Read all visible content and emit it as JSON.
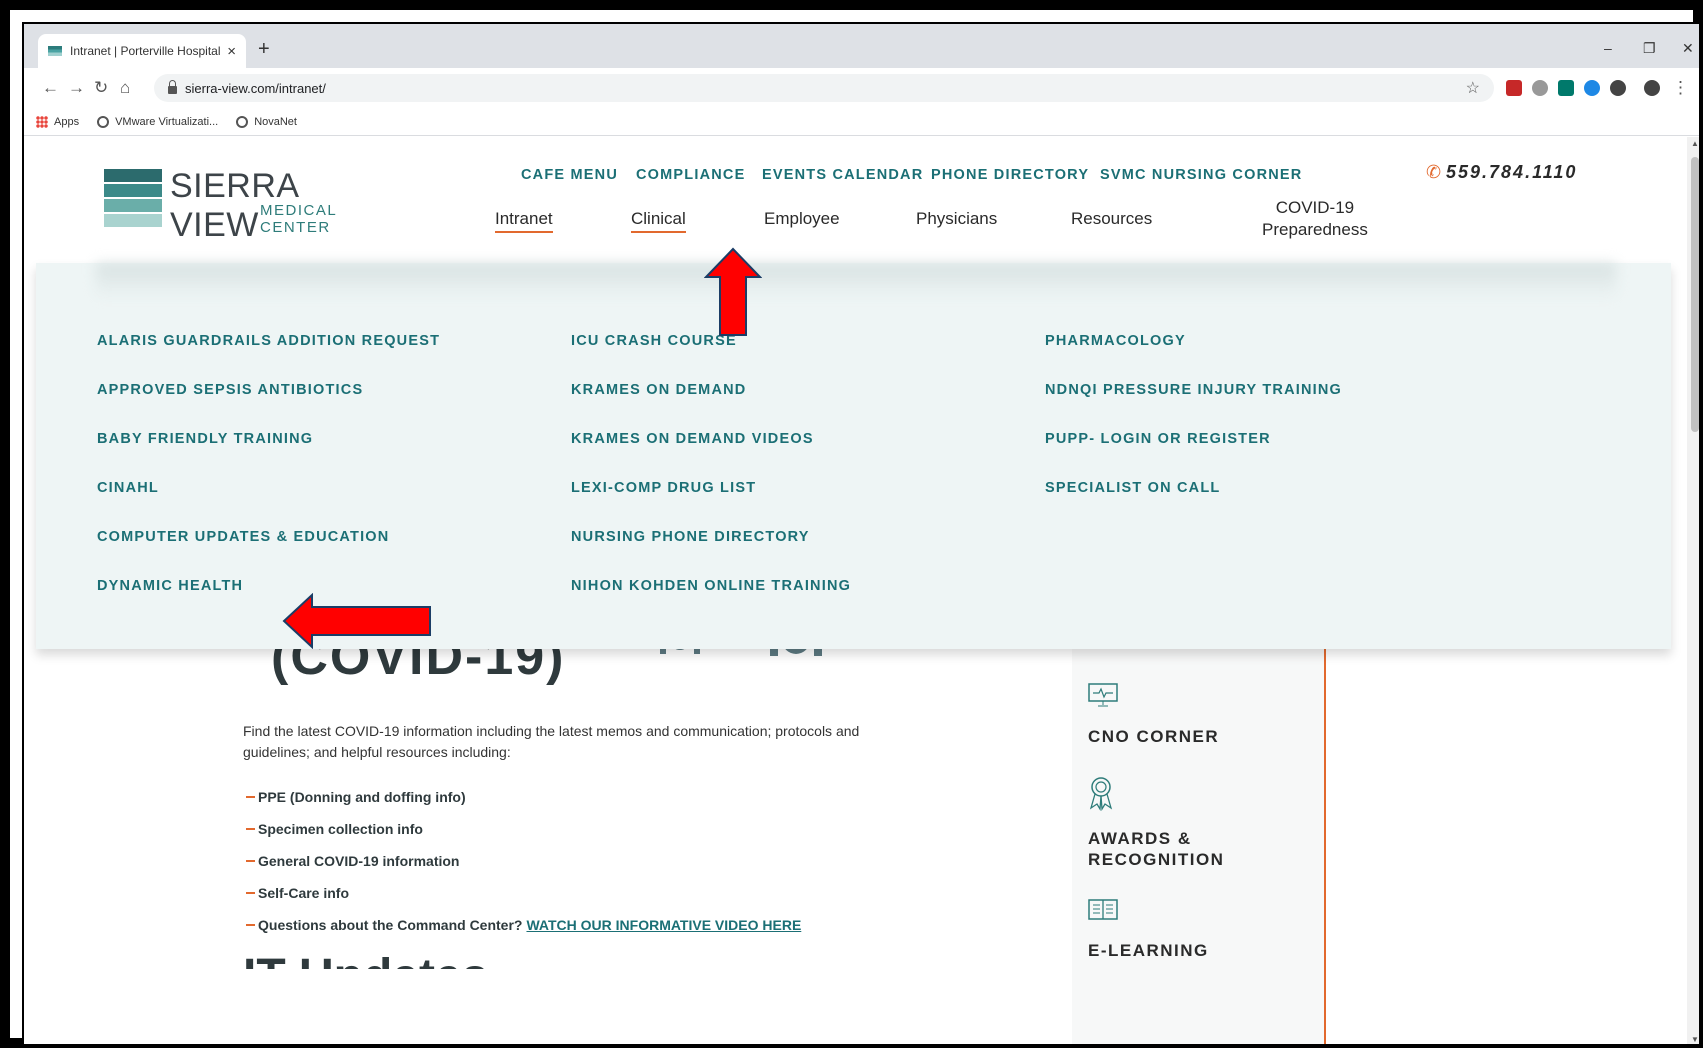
{
  "browser": {
    "tab_title": "Intranet | Porterville Hospital",
    "tab_close": "×",
    "new_tab": "+",
    "url": "sierra-view.com/intranet/",
    "window_controls": [
      "–",
      "❐",
      "✕"
    ],
    "bookmarks": [
      {
        "label": "Apps",
        "icon": "apps-grid-icon"
      },
      {
        "label": "VMware Virtualizati...",
        "icon": "globe-icon"
      },
      {
        "label": "NovaNet",
        "icon": "globe-icon"
      }
    ]
  },
  "logo": {
    "name": "SIERRA VIEW",
    "sub": "MEDICAL CENTER"
  },
  "top_links": [
    "CAFE MENU",
    "COMPLIANCE",
    "EVENTS CALENDAR",
    "PHONE DIRECTORY",
    "SVMC NURSING CORNER"
  ],
  "phone": "559.784.1110",
  "main_nav": [
    {
      "label": "Intranet",
      "active": true
    },
    {
      "label": "Clinical",
      "active": true
    },
    {
      "label": "Employee"
    },
    {
      "label": "Physicians"
    },
    {
      "label": "Resources"
    },
    {
      "label": "COVID-19 Preparedness",
      "line1": "COVID-19",
      "line2": "Preparedness"
    }
  ],
  "mega_menu": {
    "col1": [
      "ALARIS GUARDRAILS ADDITION REQUEST",
      "APPROVED SEPSIS ANTIBIOTICS",
      "BABY FRIENDLY TRAINING",
      "CINAHL",
      "COMPUTER UPDATES & EDUCATION",
      "DYNAMIC HEALTH"
    ],
    "col2": [
      "ICU CRASH COURSE",
      "KRAMES ON DEMAND",
      "KRAMES ON DEMAND VIDEOS",
      "LEXI-COMP DRUG LIST",
      "NURSING PHONE DIRECTORY",
      "NIHON KOHDEN ONLINE TRAINING"
    ],
    "col3": [
      "PHARMACOLOGY",
      "NDNQI PRESSURE INJURY TRAINING",
      "PUPP- LOGIN OR REGISTER",
      "SPECIALIST ON CALL"
    ]
  },
  "content": {
    "covid_heading": "(COVID-19)",
    "intro": "Find the latest COVID-19 information including the latest memos and communication; protocols and guidelines; and helpful resources including:",
    "bullets": [
      "PPE (Donning and doffing info)",
      "Specimen collection info",
      "General COVID-19 information",
      "Self-Care info",
      "Questions about the Command Center?"
    ],
    "video_link": "WATCH OUR INFORMATIVE VIDEO HERE",
    "it_heading": "IT Updates"
  },
  "sidebar": [
    {
      "label": "CNO CORNER",
      "icon": "monitor-heartbeat-icon"
    },
    {
      "label": "AWARDS & RECOGNITION",
      "line1": "AWARDS &",
      "line2": "RECOGNITION",
      "icon": "award-ribbon-icon"
    },
    {
      "label": "E-LEARNING",
      "icon": "open-book-icon"
    }
  ],
  "colors": {
    "teal": "#1b6f75",
    "orange": "#e2692e",
    "annotation_red": "#ff0000"
  }
}
